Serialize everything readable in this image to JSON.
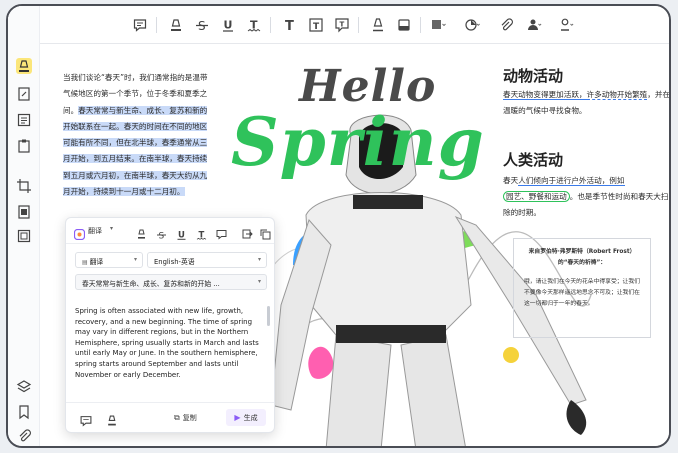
{
  "left_text": {
    "plain1": "当我们谈论“春天”时，我们通常指的是温带气候地区的第一个季节，位于冬季和夏季之间。",
    "highlighted": "春天常常与新生命、成长、复苏和新的开始联系在一起。春天的时间在不同的地区可能有所不同，但在北半球，春季通常从三月开始，到五月结束。在南半球，春天持续到五月或六月初，在南半球，春天大约从九月开始，持续到十一月或十二月初。"
  },
  "hero": {
    "hello": "Hello",
    "spring": "Spring"
  },
  "right": {
    "h1": "动物活动",
    "p1_a": "春天动物变得更加活跃，",
    "p1_b": "许多动物开始繁殖",
    "p1_c": "，并在温暖的气候中寻找食物。",
    "h2": "人类活动",
    "p2_a": "春天",
    "p2_b": "人们倾向于进行户外活动，例如",
    "p2_c": "园艺、野餐和运动",
    "p2_d": "。也是季节性时尚和春天大扫除的时期。"
  },
  "quote": {
    "title1": "来自罗伯特·弗罗斯特（Robert Frost）",
    "title2": "的“春天的祈祷”：",
    "body": "哦，请让我们在今天的花朵中得享受；让我们不要像今天那样遥远地思念不可及；让我们在这一切都归于一年的春天。"
  },
  "panel": {
    "translate_label": "翻译",
    "mode_select": "翻译",
    "lang_select": "English-英语",
    "source_select": "春天常常与新生命、成长、复苏和新的开始 ...",
    "output": "Spring is often associated with new life, growth, recovery, and a new beginning. The time of spring may vary in different regions, but in the Northern Hemisphere, spring usually starts in March and lasts until early May or June. In the southern hemisphere, spring starts around September and lasts until November or early December.",
    "copy_label": "复制",
    "generate_label": "生成"
  },
  "colors": {
    "accent": "#2fc25b",
    "highlight": "#c9daf8",
    "generate": "#8b5cf6"
  },
  "toolbar_icons": [
    "comment-icon",
    "highlighter-icon",
    "strikethrough-icon",
    "underline-icon",
    "text-icon",
    "textbox-icon",
    "text-callout-icon",
    "pen-icon",
    "eraser-icon",
    "shape-icon",
    "sticker-icon",
    "attachment-icon",
    "stamp-icon",
    "signature-icon"
  ],
  "sidebar_icons": [
    "highlight-tool-icon",
    "edit-page-icon",
    "reader-icon",
    "ocr-icon",
    "crop-icon",
    "organize-icon",
    "compare-icon",
    "layers-icon",
    "bookmark-icon",
    "attachment-icon"
  ]
}
